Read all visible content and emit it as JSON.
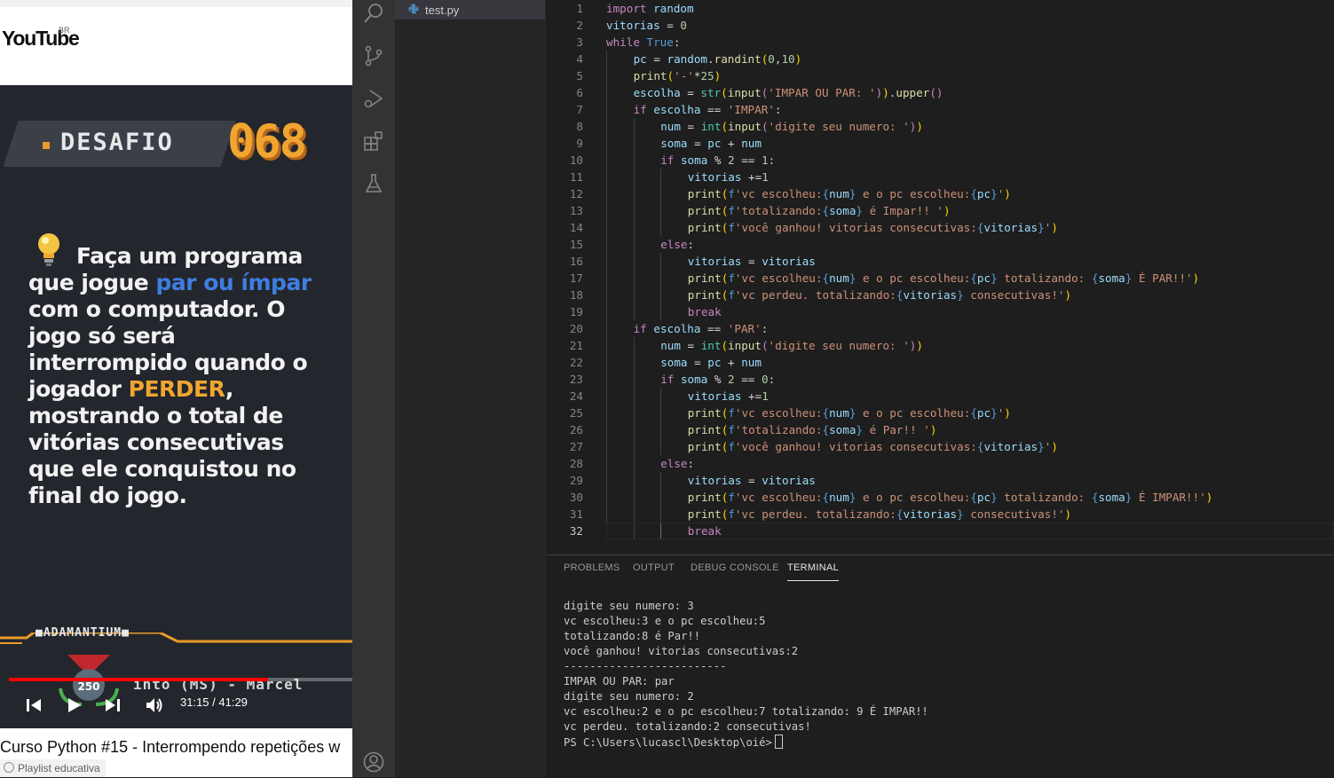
{
  "youtube": {
    "logo_text": "YouTube",
    "region": "BR",
    "video": {
      "desafio_label": "DESAFIO",
      "desafio_number": "068",
      "challenge_lines": [
        [
          "Faça um programa"
        ],
        [
          "que jogue ",
          {
            "hl": "par ou ímpar",
            "color": "blue"
          }
        ],
        [
          "com o computador. O"
        ],
        [
          "jogo só será"
        ],
        [
          "interrompido quando o"
        ],
        [
          "jogador ",
          {
            "hl": "PERDER",
            "color": "orange"
          },
          ","
        ],
        [
          "mostrando o total de"
        ],
        [
          "vitórias consecutivas"
        ],
        [
          "que ele conquistou no"
        ],
        [
          "final do jogo."
        ]
      ],
      "channel_tag": "ADAMANTIUM",
      "badge_number": "250",
      "ticker_text": "into (MS) - Marcel",
      "progress_fraction": 0.755,
      "time": "31:15 / 41:29"
    },
    "title": "Curso Python #15 - Interrompendo repetições w",
    "playlist_label": "Playlist educativa"
  },
  "explorer": {
    "file_name": "test.py"
  },
  "editor": {
    "active_line": 32,
    "lines": [
      [
        0,
        [
          [
            "k",
            "import"
          ],
          [
            "p",
            " "
          ],
          [
            "v",
            "random"
          ]
        ]
      ],
      [
        0,
        [
          [
            "v",
            "vitorias"
          ],
          [
            "p",
            " = "
          ],
          [
            "n",
            "0"
          ]
        ]
      ],
      [
        0,
        [
          [
            "k",
            "while"
          ],
          [
            "p",
            " "
          ],
          [
            "kb",
            "True"
          ],
          [
            "p",
            ":"
          ]
        ]
      ],
      [
        1,
        [
          [
            "v",
            "pc"
          ],
          [
            "p",
            " = "
          ],
          [
            "v",
            "random"
          ],
          [
            "p",
            "."
          ],
          [
            "fn",
            "randint"
          ],
          [
            "br",
            "("
          ],
          [
            "n",
            "0"
          ],
          [
            "p",
            ","
          ],
          [
            "n",
            "10"
          ],
          [
            "br",
            ")"
          ]
        ]
      ],
      [
        1,
        [
          [
            "fn",
            "print"
          ],
          [
            "br",
            "("
          ],
          [
            "s",
            "'-'"
          ],
          [
            "p",
            "*"
          ],
          [
            "n",
            "25"
          ],
          [
            "br",
            ")"
          ]
        ]
      ],
      [
        1,
        [
          [
            "v",
            "escolha"
          ],
          [
            "p",
            " = "
          ],
          [
            "bt",
            "str"
          ],
          [
            "br",
            "("
          ],
          [
            "fn",
            "input"
          ],
          [
            "k",
            "("
          ],
          [
            "s",
            "'IMPAR OU PAR: '"
          ],
          [
            "k",
            ")"
          ],
          [
            "br",
            ")"
          ],
          [
            "p",
            "."
          ],
          [
            "fn",
            "upper"
          ],
          [
            "k",
            "()"
          ]
        ]
      ],
      [
        1,
        [
          [
            "k",
            "if"
          ],
          [
            "p",
            " "
          ],
          [
            "v",
            "escolha"
          ],
          [
            "p",
            " == "
          ],
          [
            "s",
            "'IMPAR'"
          ],
          [
            "p",
            ":"
          ]
        ]
      ],
      [
        2,
        [
          [
            "v",
            "num"
          ],
          [
            "p",
            " = "
          ],
          [
            "bt",
            "int"
          ],
          [
            "br",
            "("
          ],
          [
            "fn",
            "input"
          ],
          [
            "k",
            "("
          ],
          [
            "s",
            "'digite seu numero: '"
          ],
          [
            "k",
            ")"
          ],
          [
            "br",
            ")"
          ]
        ]
      ],
      [
        2,
        [
          [
            "v",
            "soma"
          ],
          [
            "p",
            " = "
          ],
          [
            "v",
            "pc"
          ],
          [
            "p",
            " + "
          ],
          [
            "v",
            "num"
          ]
        ]
      ],
      [
        2,
        [
          [
            "k",
            "if"
          ],
          [
            "p",
            " "
          ],
          [
            "v",
            "soma"
          ],
          [
            "p",
            " % "
          ],
          [
            "n",
            "2"
          ],
          [
            "p",
            " == "
          ],
          [
            "n",
            "1"
          ],
          [
            "p",
            ":"
          ]
        ]
      ],
      [
        3,
        [
          [
            "v",
            "vitorias"
          ],
          [
            "p",
            " +="
          ],
          [
            "n",
            "1"
          ]
        ]
      ],
      [
        3,
        [
          [
            "fn",
            "print"
          ],
          [
            "br",
            "("
          ],
          [
            "kb",
            "f"
          ],
          [
            "s",
            "'vc escolheu:"
          ],
          [
            "kb",
            "{"
          ],
          [
            "v",
            "num"
          ],
          [
            "kb",
            "}"
          ],
          [
            "s",
            " e o pc escolheu:"
          ],
          [
            "kb",
            "{"
          ],
          [
            "v",
            "pc"
          ],
          [
            "kb",
            "}"
          ],
          [
            "s",
            "'"
          ],
          [
            "br",
            ")"
          ]
        ]
      ],
      [
        3,
        [
          [
            "fn",
            "print"
          ],
          [
            "br",
            "("
          ],
          [
            "kb",
            "f"
          ],
          [
            "s",
            "'totalizando:"
          ],
          [
            "kb",
            "{"
          ],
          [
            "v",
            "soma"
          ],
          [
            "kb",
            "}"
          ],
          [
            "s",
            " é Impar!! '"
          ],
          [
            "br",
            ")"
          ]
        ]
      ],
      [
        3,
        [
          [
            "fn",
            "print"
          ],
          [
            "br",
            "("
          ],
          [
            "kb",
            "f"
          ],
          [
            "s",
            "'você ganhou! vitorias consecutivas:"
          ],
          [
            "kb",
            "{"
          ],
          [
            "v",
            "vitorias"
          ],
          [
            "kb",
            "}"
          ],
          [
            "s",
            "'"
          ],
          [
            "br",
            ")"
          ]
        ]
      ],
      [
        2,
        [
          [
            "k",
            "else"
          ],
          [
            "p",
            ":"
          ]
        ]
      ],
      [
        3,
        [
          [
            "v",
            "vitorias"
          ],
          [
            "p",
            " = "
          ],
          [
            "v",
            "vitorias"
          ]
        ]
      ],
      [
        3,
        [
          [
            "fn",
            "print"
          ],
          [
            "br",
            "("
          ],
          [
            "kb",
            "f"
          ],
          [
            "s",
            "'vc escolheu:"
          ],
          [
            "kb",
            "{"
          ],
          [
            "v",
            "num"
          ],
          [
            "kb",
            "}"
          ],
          [
            "s",
            " e o pc escolheu:"
          ],
          [
            "kb",
            "{"
          ],
          [
            "v",
            "pc"
          ],
          [
            "kb",
            "}"
          ],
          [
            "s",
            " totalizando: "
          ],
          [
            "kb",
            "{"
          ],
          [
            "v",
            "soma"
          ],
          [
            "kb",
            "}"
          ],
          [
            "s",
            " É PAR!!'"
          ],
          [
            "br",
            ")"
          ]
        ]
      ],
      [
        3,
        [
          [
            "fn",
            "print"
          ],
          [
            "br",
            "("
          ],
          [
            "kb",
            "f"
          ],
          [
            "s",
            "'vc perdeu. totalizando:"
          ],
          [
            "kb",
            "{"
          ],
          [
            "v",
            "vitorias"
          ],
          [
            "kb",
            "}"
          ],
          [
            "s",
            " consecutivas!'"
          ],
          [
            "br",
            ")"
          ]
        ]
      ],
      [
        3,
        [
          [
            "k",
            "break"
          ]
        ]
      ],
      [
        1,
        [
          [
            "k",
            "if"
          ],
          [
            "p",
            " "
          ],
          [
            "v",
            "escolha"
          ],
          [
            "p",
            " == "
          ],
          [
            "s",
            "'PAR'"
          ],
          [
            "p",
            ":"
          ]
        ]
      ],
      [
        2,
        [
          [
            "v",
            "num"
          ],
          [
            "p",
            " = "
          ],
          [
            "bt",
            "int"
          ],
          [
            "br",
            "("
          ],
          [
            "fn",
            "input"
          ],
          [
            "k",
            "("
          ],
          [
            "s",
            "'digite seu numero: '"
          ],
          [
            "k",
            ")"
          ],
          [
            "br",
            ")"
          ]
        ]
      ],
      [
        2,
        [
          [
            "v",
            "soma"
          ],
          [
            "p",
            " = "
          ],
          [
            "v",
            "pc"
          ],
          [
            "p",
            " + "
          ],
          [
            "v",
            "num"
          ]
        ]
      ],
      [
        2,
        [
          [
            "k",
            "if"
          ],
          [
            "p",
            " "
          ],
          [
            "v",
            "soma"
          ],
          [
            "p",
            " % "
          ],
          [
            "n",
            "2"
          ],
          [
            "p",
            " == "
          ],
          [
            "n",
            "0"
          ],
          [
            "p",
            ":"
          ]
        ]
      ],
      [
        3,
        [
          [
            "v",
            "vitorias"
          ],
          [
            "p",
            " +="
          ],
          [
            "n",
            "1"
          ]
        ]
      ],
      [
        3,
        [
          [
            "fn",
            "print"
          ],
          [
            "br",
            "("
          ],
          [
            "kb",
            "f"
          ],
          [
            "s",
            "'vc escolheu:"
          ],
          [
            "kb",
            "{"
          ],
          [
            "v",
            "num"
          ],
          [
            "kb",
            "}"
          ],
          [
            "s",
            " e o pc escolheu:"
          ],
          [
            "kb",
            "{"
          ],
          [
            "v",
            "pc"
          ],
          [
            "kb",
            "}"
          ],
          [
            "s",
            "'"
          ],
          [
            "br",
            ")"
          ]
        ]
      ],
      [
        3,
        [
          [
            "fn",
            "print"
          ],
          [
            "br",
            "("
          ],
          [
            "kb",
            "f"
          ],
          [
            "s",
            "'totalizando:"
          ],
          [
            "kb",
            "{"
          ],
          [
            "v",
            "soma"
          ],
          [
            "kb",
            "}"
          ],
          [
            "s",
            " é Par!! '"
          ],
          [
            "br",
            ")"
          ]
        ]
      ],
      [
        3,
        [
          [
            "fn",
            "print"
          ],
          [
            "br",
            "("
          ],
          [
            "kb",
            "f"
          ],
          [
            "s",
            "'você ganhou! vitorias consecutivas:"
          ],
          [
            "kb",
            "{"
          ],
          [
            "v",
            "vitorias"
          ],
          [
            "kb",
            "}"
          ],
          [
            "s",
            "'"
          ],
          [
            "br",
            ")"
          ]
        ]
      ],
      [
        2,
        [
          [
            "k",
            "else"
          ],
          [
            "p",
            ":"
          ]
        ]
      ],
      [
        3,
        [
          [
            "v",
            "vitorias"
          ],
          [
            "p",
            " = "
          ],
          [
            "v",
            "vitorias"
          ]
        ]
      ],
      [
        3,
        [
          [
            "fn",
            "print"
          ],
          [
            "br",
            "("
          ],
          [
            "kb",
            "f"
          ],
          [
            "s",
            "'vc escolheu:"
          ],
          [
            "kb",
            "{"
          ],
          [
            "v",
            "num"
          ],
          [
            "kb",
            "}"
          ],
          [
            "s",
            " e o pc escolheu:"
          ],
          [
            "kb",
            "{"
          ],
          [
            "v",
            "pc"
          ],
          [
            "kb",
            "}"
          ],
          [
            "s",
            " totalizando: "
          ],
          [
            "kb",
            "{"
          ],
          [
            "v",
            "soma"
          ],
          [
            "kb",
            "}"
          ],
          [
            "s",
            " É IMPAR!!'"
          ],
          [
            "br",
            ")"
          ]
        ]
      ],
      [
        3,
        [
          [
            "fn",
            "print"
          ],
          [
            "br",
            "("
          ],
          [
            "kb",
            "f"
          ],
          [
            "s",
            "'vc perdeu. totalizando:"
          ],
          [
            "kb",
            "{"
          ],
          [
            "v",
            "vitorias"
          ],
          [
            "kb",
            "}"
          ],
          [
            "s",
            " consecutivas!'"
          ],
          [
            "br",
            ")"
          ]
        ]
      ],
      [
        3,
        [
          [
            "k",
            "break"
          ]
        ]
      ]
    ]
  },
  "panel": {
    "tabs": [
      "PROBLEMS",
      "OUTPUT",
      "DEBUG CONSOLE",
      "TERMINAL"
    ],
    "active_tab": "TERMINAL",
    "terminal_lines": [
      "digite seu numero: 3",
      "vc escolheu:3 e o pc escolheu:5",
      "totalizando:8 é Par!!",
      "você ganhou! vitorias consecutivas:2",
      "-------------------------",
      "IMPAR OU PAR: par",
      "digite seu numero: 2",
      "vc escolheu:2 e o pc escolheu:7 totalizando: 9 É IMPAR!!",
      "vc perdeu. totalizando:2 consecutivas!"
    ],
    "prompt": "PS C:\\Users\\lucascl\\Desktop\\oié>"
  },
  "icons": {
    "activity_bar": [
      "search-icon",
      "source-control-icon",
      "run-debug-icon",
      "extensions-icon",
      "testing-icon",
      "account-icon"
    ],
    "player": [
      "previous-icon",
      "play-icon",
      "next-icon",
      "volume-icon"
    ]
  },
  "colors": {
    "vscode_bg": "#1e1e1e",
    "activity_bar": "#333333",
    "sidebar": "#252526",
    "youtube_red": "#ff0000",
    "desafio_orange": "#f0a531",
    "highlight_blue": "#3f7de0"
  }
}
